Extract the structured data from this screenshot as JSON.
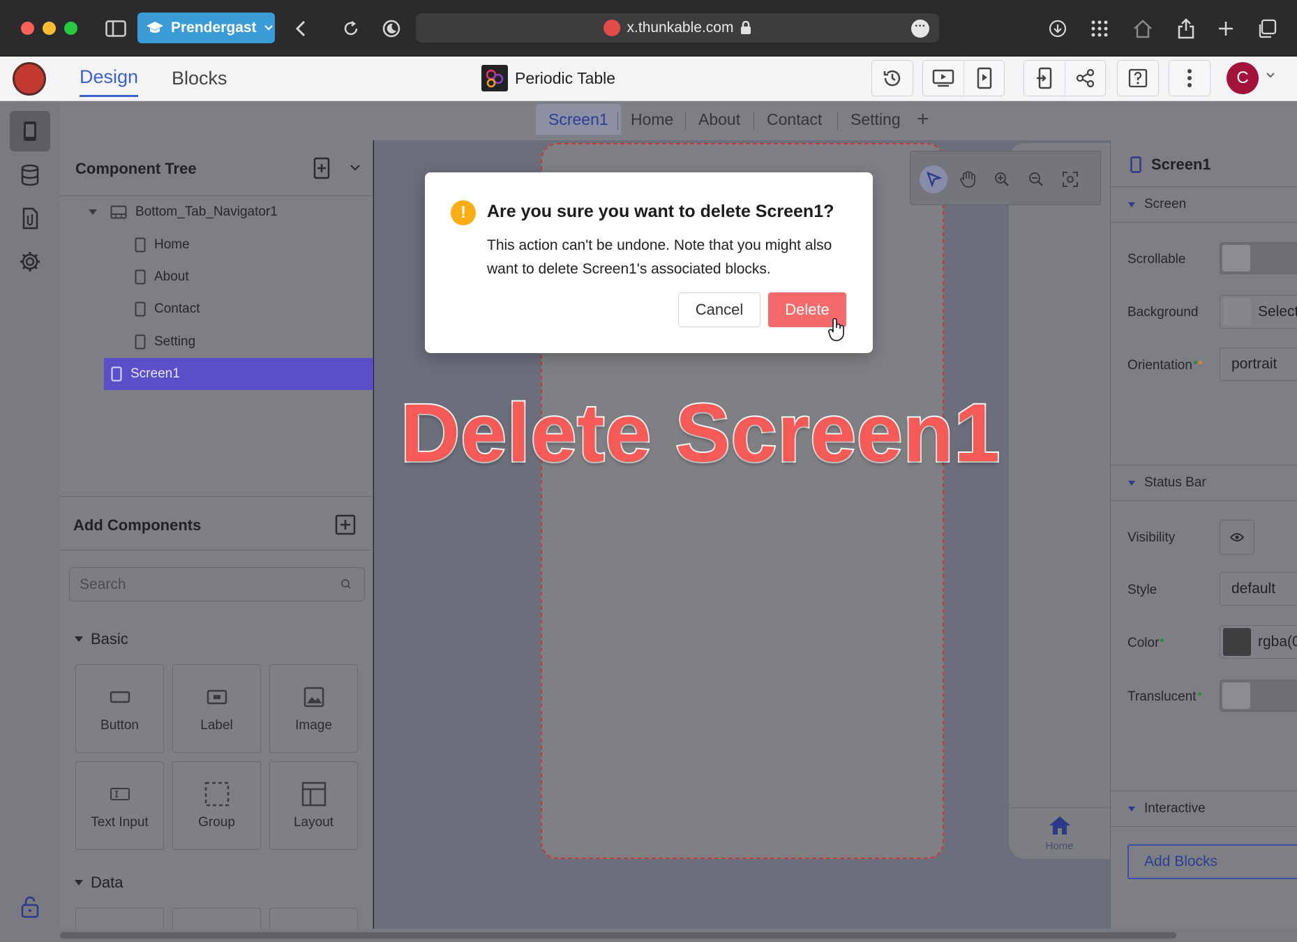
{
  "browser": {
    "profile_name": "Prendergast",
    "url": "x.thunkable.com"
  },
  "app": {
    "tabs": {
      "design": "Design",
      "blocks": "Blocks"
    },
    "project_title": "Periodic Table",
    "avatar_initial": "C"
  },
  "screens": {
    "tabs": [
      "Screen1",
      "Home",
      "About",
      "Contact",
      "Setting"
    ],
    "add_label": "+"
  },
  "component_tree": {
    "title": "Component Tree",
    "root": "Bottom_Tab_Navigator1",
    "children": [
      "Home",
      "About",
      "Contact",
      "Setting"
    ],
    "selected": "Screen1"
  },
  "add_components": {
    "title": "Add Components",
    "search_placeholder": "Search",
    "sections": {
      "basic": "Basic",
      "data": "Data"
    },
    "basic_items": [
      "Button",
      "Label",
      "Image",
      "Text Input",
      "Group",
      "Layout"
    ]
  },
  "canvas": {
    "preview_tab_label": "Home"
  },
  "properties": {
    "title": "Screen1",
    "sections": {
      "screen": "Screen",
      "status_bar": "Status Bar",
      "interactive": "Interactive"
    },
    "scrollable_label": "Scrollable",
    "background_label": "Background",
    "background_value": "Select",
    "orientation_label": "Orientation",
    "orientation_value": "portrait",
    "visibility_label": "Visibility",
    "style_label": "Style",
    "style_value": "default",
    "color_label": "Color",
    "color_value": "rgba(0",
    "translucent_label": "Translucent",
    "add_blocks_label": "Add Blocks"
  },
  "dialog": {
    "icon": "!",
    "title": "Are you sure you want to delete Screen1?",
    "message": "This action can't be undone. Note that you might also want to delete Screen1's associated blocks.",
    "cancel_label": "Cancel",
    "delete_label": "Delete"
  },
  "overlay_caption": "Delete Screen1",
  "colors": {
    "accent": "#3d63c9",
    "selected_row": "#5a4fc7",
    "delete_button": "#f56a6a",
    "warning": "#faad14",
    "caption": "#f65a57"
  }
}
